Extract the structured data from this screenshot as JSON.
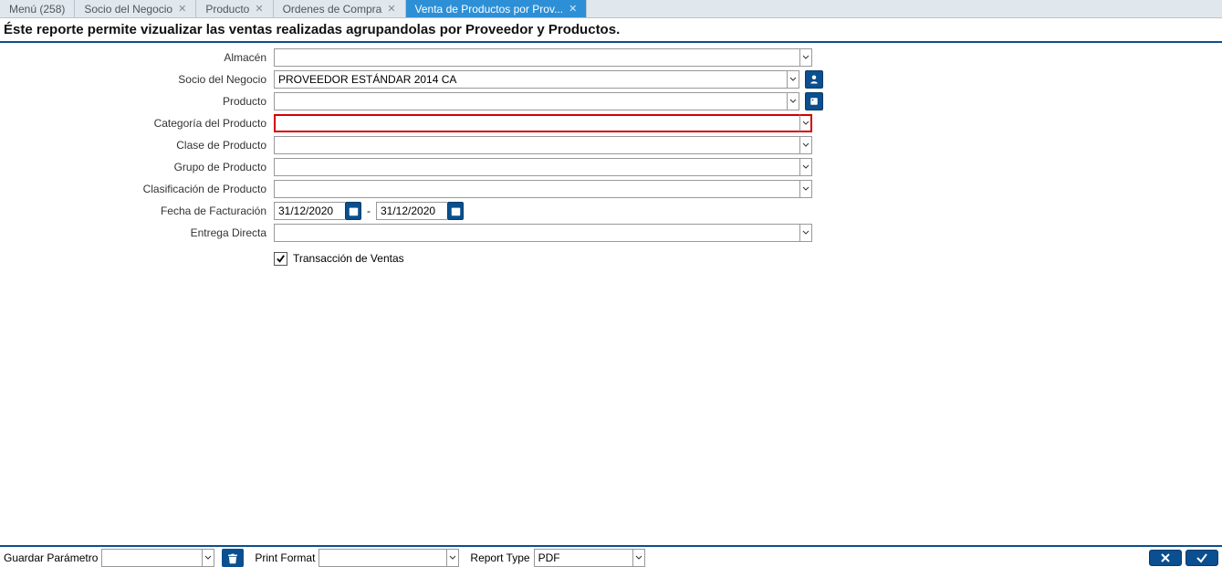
{
  "tabs": [
    {
      "label": "Menú (258)",
      "closable": false,
      "active": false
    },
    {
      "label": "Socio del Negocio",
      "closable": true,
      "active": false
    },
    {
      "label": "Producto",
      "closable": true,
      "active": false
    },
    {
      "label": "Ordenes de Compra",
      "closable": true,
      "active": false
    },
    {
      "label": "Venta de Productos por Prov...",
      "closable": true,
      "active": true
    }
  ],
  "description": "Éste reporte permite vizualizar las ventas realizadas agrupandolas por Proveedor y Productos.",
  "form": {
    "almacen": {
      "label": "Almacén",
      "value": ""
    },
    "socio": {
      "label": "Socio del Negocio",
      "value": "PROVEEDOR ESTÁNDAR 2014 CA"
    },
    "producto": {
      "label": "Producto",
      "value": ""
    },
    "categoria": {
      "label": "Categoría del Producto",
      "value": ""
    },
    "clase": {
      "label": "Clase de Producto",
      "value": ""
    },
    "grupo": {
      "label": "Grupo de Producto",
      "value": ""
    },
    "clasificacion": {
      "label": "Clasificación de Producto",
      "value": ""
    },
    "fecha_fact": {
      "label": "Fecha de Facturación",
      "from": "31/12/2020",
      "to": "31/12/2020",
      "separator": "-"
    },
    "entrega": {
      "label": "Entrega Directa",
      "value": ""
    },
    "trans_ventas": {
      "label": "Transacción de Ventas",
      "checked": true
    }
  },
  "footer": {
    "guardar_param": {
      "label": "Guardar Parámetro",
      "value": ""
    },
    "print_format": {
      "label": "Print Format",
      "value": ""
    },
    "report_type": {
      "label": "Report Type",
      "value": "PDF"
    }
  }
}
